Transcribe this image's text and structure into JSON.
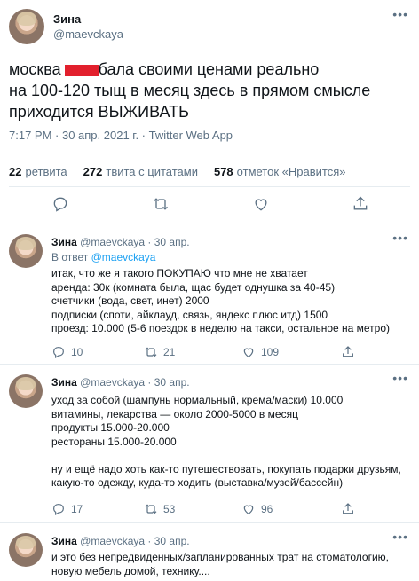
{
  "tweet": {
    "author_name": "Зина",
    "author_handle": "@maevckaya",
    "text_lines": [
      "москва",
      "бала своими ценами реально",
      "на 100-120 тыщ в месяц здесь в прямом смысле",
      "приходится ВЫЖИВАТЬ"
    ],
    "meta": "7:17 PM · 30 апр. 2021 г. · Twitter Web App",
    "stats": {
      "retweets_count": "22",
      "retweets_label": "ретвита",
      "quotes_count": "272",
      "quotes_label": "твита с цитатами",
      "likes_count": "578",
      "likes_label": "отметок «Нравится»"
    },
    "icons": [
      "reply-icon",
      "retweet-icon",
      "like-icon",
      "share-icon"
    ],
    "censor_color": "#e2202d"
  },
  "replies": [
    {
      "author_name": "Зина",
      "author_handle": "@maevckaya",
      "date": "· 30 апр.",
      "reply_to_prefix": "В ответ",
      "reply_to_handle": "@maevckaya",
      "lines": [
        "итак, что же я такого ПОКУПАЮ что мне не хватает",
        "аренда: 30к (комната была, щас будет однушка за 40-45)",
        "счетчики (вода, свет, инет) 2000",
        "подписки (споти, айклауд, связь, яндекс плюс итд) 1500",
        "проезд: 10.000 (5-6 поездок в неделю на такси, остальное на метро)"
      ],
      "reply_count": "10",
      "retweet_count": "21",
      "like_count": "109"
    },
    {
      "author_name": "Зина",
      "author_handle": "@maevckaya",
      "date": "· 30 апр.",
      "lines": [
        "уход за собой (шампунь нормальный, крема/маски) 10.000",
        "витамины, лекарства — около 2000-5000 в месяц",
        "продукты 15.000-20.000",
        "рестораны 15.000-20.000",
        "",
        "ну и ещё надо хоть как-то путешествовать, покупать подарки друзьям,",
        "какую-то одежду, куда-то ходить (выставка/музей/бассейн)"
      ],
      "reply_count": "17",
      "retweet_count": "53",
      "like_count": "96"
    },
    {
      "author_name": "Зина",
      "author_handle": "@maevckaya",
      "date": "· 30 апр.",
      "lines": [
        "и это без непредвиденных/запланированных трат на стоматологию,",
        "новую мебель домой, технику...."
      ]
    }
  ]
}
